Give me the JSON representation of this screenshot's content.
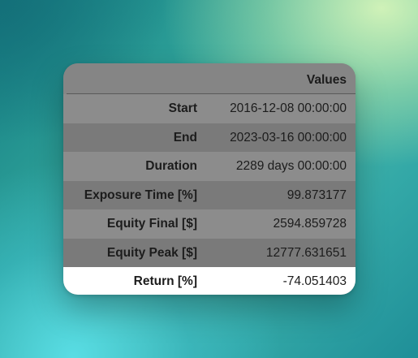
{
  "table": {
    "header": "Values",
    "rows": [
      {
        "label": "Start",
        "value": "2016-12-08 00:00:00"
      },
      {
        "label": "End",
        "value": "2023-03-16 00:00:00"
      },
      {
        "label": "Duration",
        "value": "2289 days 00:00:00"
      },
      {
        "label": "Exposure Time [%]",
        "value": "99.873177"
      },
      {
        "label": "Equity Final [$]",
        "value": "2594.859728"
      },
      {
        "label": "Equity Peak [$]",
        "value": "12777.631651"
      },
      {
        "label": "Return [%]",
        "value": "-74.051403"
      }
    ]
  },
  "colors": {
    "panel": "#7f7f7f",
    "row_alt": "#7a7a7a",
    "row_plain": "#8c8c8c",
    "row_highlight": "#ffffff",
    "text": "#1c1c1c"
  }
}
